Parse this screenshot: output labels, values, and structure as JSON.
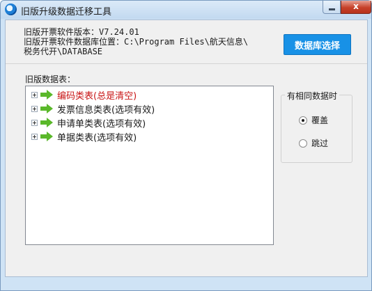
{
  "window": {
    "title": "旧版升级数据迁移工具",
    "icon": "app-logo-icon",
    "minimize_icon": "minimize-icon",
    "close_icon": "close-icon",
    "close_glyph": "x"
  },
  "info": {
    "version_line": "旧版开票软件版本：V7.24.01",
    "location_line1": "旧版开票软件数据库位置：C:\\Program Files\\航天信息\\",
    "location_line2": "税务代开\\DATABASE"
  },
  "db_button": {
    "label": "数据库选择",
    "color": "#1891e6"
  },
  "tables": {
    "label": "旧版数据表：",
    "items": [
      {
        "label": "编码类表(总是清空)",
        "color": "#c81414"
      },
      {
        "label": "发票信息类表(选项有效)"
      },
      {
        "label": "申请单类表(选项有效)"
      },
      {
        "label": "单据类表(选项有效)"
      }
    ],
    "arrow_icon": "green-arrow-icon",
    "arrow_color": "#5ab82a"
  },
  "options": {
    "legend": "有相同数据时",
    "radios": [
      {
        "label": "覆盖",
        "checked": true
      },
      {
        "label": "跳过",
        "checked": false
      }
    ]
  }
}
